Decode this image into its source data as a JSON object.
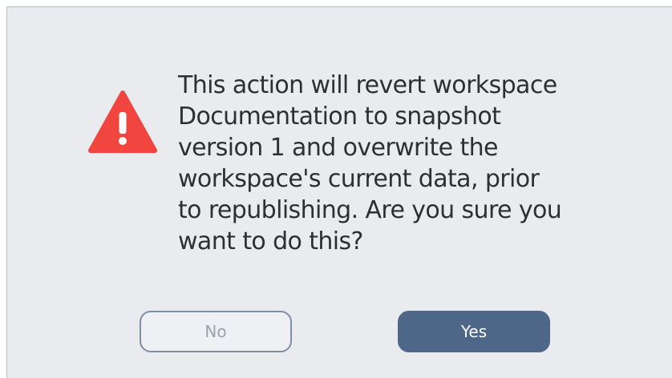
{
  "dialog": {
    "message": "This action will revert workspace\nDocumentation to snapshot\nversion 1 and overwrite the\nworkspace's current data, prior\nto republishing. Are you sure you\nwant to do this?",
    "icon": "warning-icon",
    "no_label": "No",
    "yes_label": "Yes"
  },
  "colors": {
    "warning": "#f0463f",
    "primary": "#4e6789",
    "background": "#e9ebef"
  }
}
